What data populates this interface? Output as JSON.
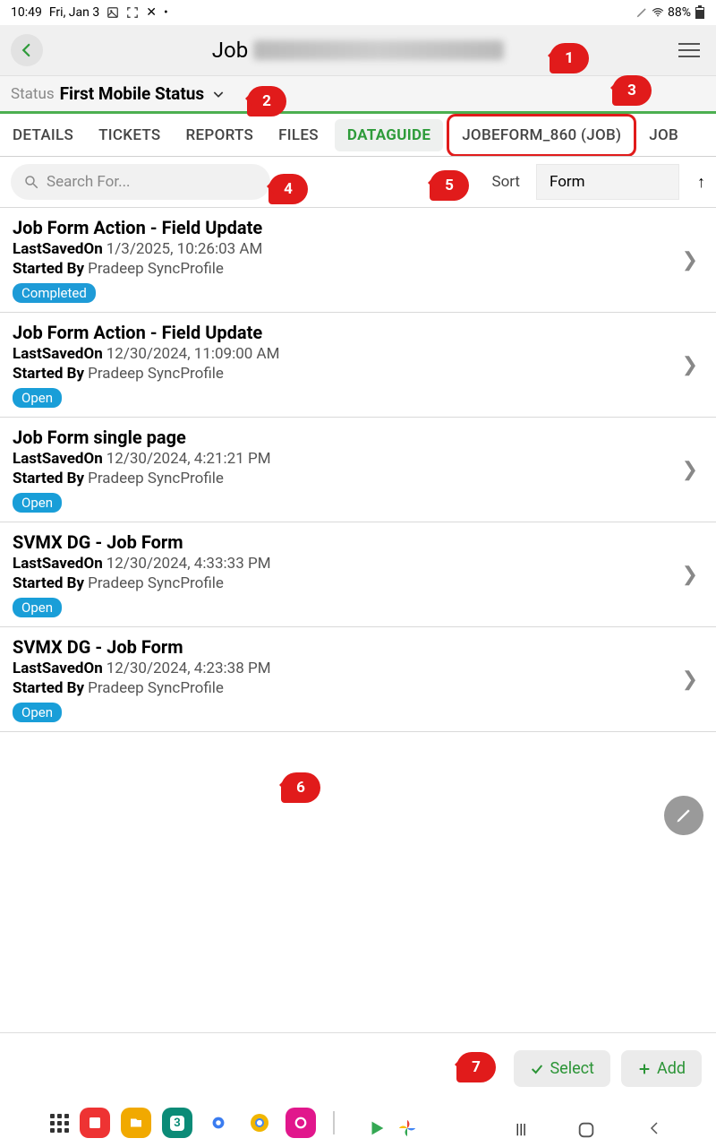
{
  "status_bar": {
    "time": "10:49",
    "date": "Fri, Jan 3",
    "battery": "88%"
  },
  "header": {
    "title": "Job"
  },
  "status": {
    "label": "Status",
    "value": "First Mobile Status"
  },
  "tabs": {
    "t1": "DETAILS",
    "t2": "TICKETS",
    "t3": "REPORTS",
    "t4": "FILES",
    "t5": "DATAGUIDE",
    "t6": "JOBEFORM_860 (JOB)",
    "t7": "JOB"
  },
  "search": {
    "placeholder": "Search For..."
  },
  "sort": {
    "label": "Sort",
    "value": "Form"
  },
  "items": [
    {
      "title": "Job Form Action - Field Update",
      "saved": "1/3/2025, 10:26:03 AM",
      "by": "Pradeep SyncProfile",
      "status": "Completed"
    },
    {
      "title": "Job Form Action - Field Update",
      "saved": "12/30/2024, 11:09:00 AM",
      "by": "Pradeep SyncProfile",
      "status": "Open"
    },
    {
      "title": "Job Form single page",
      "saved": "12/30/2024, 4:21:21 PM",
      "by": "Pradeep SyncProfile",
      "status": "Open"
    },
    {
      "title": "SVMX DG - Job Form",
      "saved": "12/30/2024, 4:33:33 PM",
      "by": "Pradeep SyncProfile",
      "status": "Open"
    },
    {
      "title": "SVMX DG - Job Form",
      "saved": "12/30/2024, 4:23:38 PM",
      "by": "Pradeep SyncProfile",
      "status": "Open"
    }
  ],
  "labels": {
    "saved": "LastSavedOn",
    "by": "Started By"
  },
  "buttons": {
    "select": "Select",
    "add": "Add"
  },
  "callouts": {
    "c1": "1",
    "c2": "2",
    "c3": "3",
    "c4": "4",
    "c5": "5",
    "c6": "6",
    "c7": "7"
  }
}
